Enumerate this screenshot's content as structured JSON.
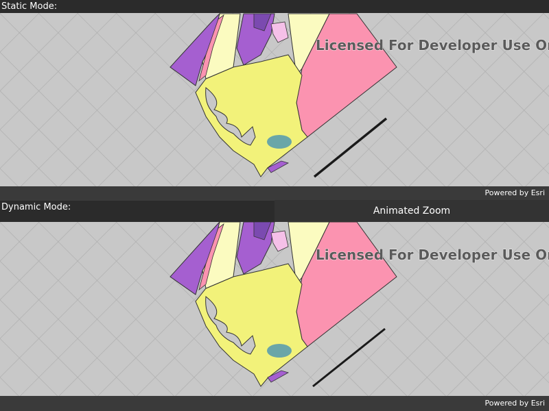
{
  "static_panel": {
    "label": "Static Mode:",
    "watermark": "Licensed For Developer Use Only",
    "attribution": "Powered by Esri"
  },
  "dynamic_panel": {
    "label": "Dynamic Mode:",
    "button_label": "Animated Zoom",
    "watermark": "Licensed For Developer Use Only",
    "attribution": "Powered by Esri"
  },
  "colors": {
    "basemap_grid": "#c8c8c8",
    "land_yellow": "#f2f27a",
    "land_light_yellow": "#fbfbc0",
    "land_pink": "#fb93b0",
    "land_purple": "#a55fd0",
    "land_dark_purple": "#7b4ab0",
    "land_light_pink": "#f5c0e8",
    "water_teal": "#6aa6a8"
  },
  "icons": [
    "scale-line",
    "map-tile-grid"
  ]
}
